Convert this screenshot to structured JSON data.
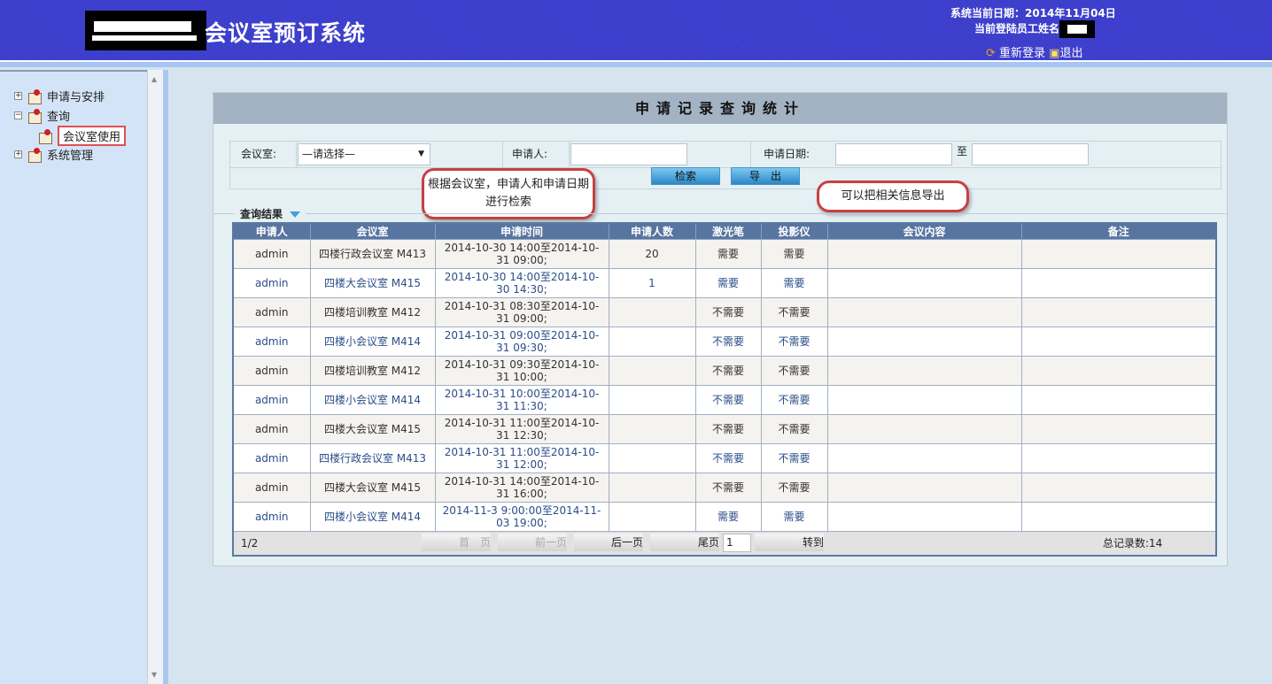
{
  "header": {
    "title": "会议室预订系统",
    "date_label": "系统当前日期：2014年11月04日",
    "user_label": "当前登陆员工姓名",
    "relogin": "重新登录",
    "logout": "退出"
  },
  "sidebar": {
    "items": [
      {
        "label": "申请与安排",
        "toggle": "+"
      },
      {
        "label": "查询",
        "toggle": "−"
      },
      {
        "label": "会议室使用"
      },
      {
        "label": "系统管理",
        "toggle": "+"
      }
    ]
  },
  "panel": {
    "title": "申请记录查询统计",
    "form": {
      "room_label": "会议室:",
      "room_value": "—请选择—",
      "applicant_label": "申请人:",
      "applicant_value": "",
      "date_label": "申请日期:",
      "date_from": "",
      "to_label": "至",
      "date_to": "",
      "search": "检索",
      "export": "导　出"
    },
    "callouts": {
      "search": "根据会议室，申请人和申请日期进行检索",
      "export": "可以把相关信息导出"
    },
    "results_label": "查询结果"
  },
  "table": {
    "headers": [
      "申请人",
      "会议室",
      "申请时间",
      "申请人数",
      "激光笔",
      "投影仪",
      "会议内容",
      "备注"
    ],
    "rows": [
      [
        "admin",
        "四楼行政会议室  M413",
        "2014-10-30 14:00至2014-10-31 09:00;",
        "20",
        "需要",
        "需要",
        "",
        ""
      ],
      [
        "admin",
        "四楼大会议室  M415",
        "2014-10-30 14:00至2014-10-30 14:30;",
        "1",
        "需要",
        "需要",
        "",
        ""
      ],
      [
        "admin",
        "四楼培训教室  M412",
        "2014-10-31 08:30至2014-10-31 09:00;",
        "",
        "不需要",
        "不需要",
        "",
        ""
      ],
      [
        "admin",
        "四楼小会议室  M414",
        "2014-10-31 09:00至2014-10-31 09:30;",
        "",
        "不需要",
        "不需要",
        "",
        ""
      ],
      [
        "admin",
        "四楼培训教室  M412",
        "2014-10-31 09:30至2014-10-31 10:00;",
        "",
        "不需要",
        "不需要",
        "",
        ""
      ],
      [
        "admin",
        "四楼小会议室  M414",
        "2014-10-31 10:00至2014-10-31 11:30;",
        "",
        "不需要",
        "不需要",
        "",
        ""
      ],
      [
        "admin",
        "四楼大会议室  M415",
        "2014-10-31 11:00至2014-10-31 12:30;",
        "",
        "不需要",
        "不需要",
        "",
        ""
      ],
      [
        "admin",
        "四楼行政会议室  M413",
        "2014-10-31 11:00至2014-10-31 12:00;",
        "",
        "不需要",
        "不需要",
        "",
        ""
      ],
      [
        "admin",
        "四楼大会议室  M415",
        "2014-10-31 14:00至2014-10-31 16:00;",
        "",
        "不需要",
        "不需要",
        "",
        ""
      ],
      [
        "admin",
        "四楼小会议室  M414",
        "2014-11-3 9:00:00至2014-11-03 19:00;",
        "",
        "需要",
        "需要",
        "",
        ""
      ]
    ]
  },
  "pager": {
    "page": "1/2",
    "first": "首　页",
    "prev": "前一页",
    "next": "后一页",
    "last": "尾页",
    "input": "1",
    "go": "转到",
    "total": "总记录数:14"
  }
}
